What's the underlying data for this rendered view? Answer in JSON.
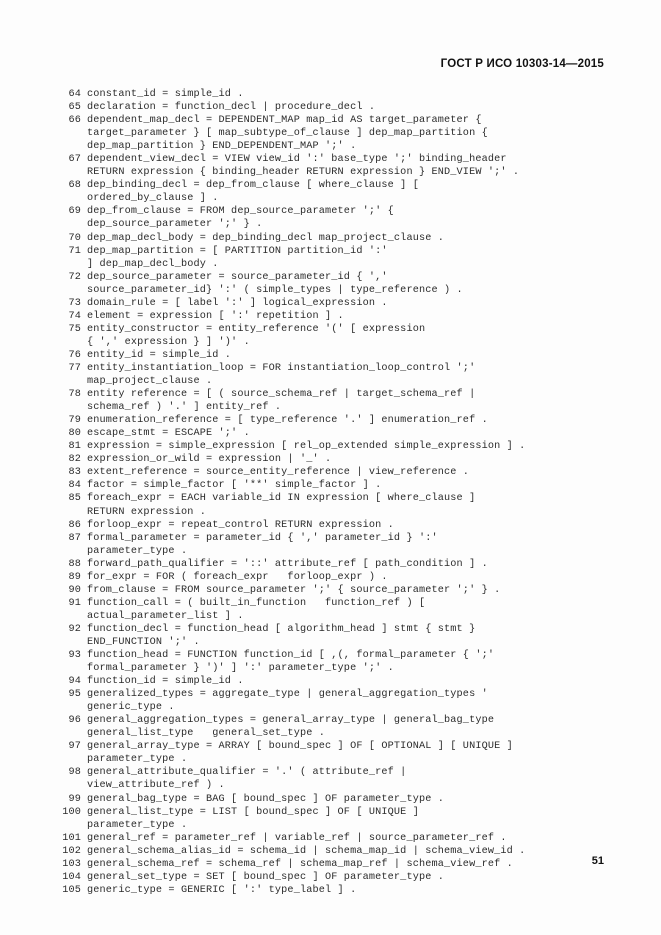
{
  "header": {
    "standard_designation": "ГОСТ Р ИСО 10303-14—2015"
  },
  "footer": {
    "page_number": "51"
  },
  "listing": {
    "rules": [
      {
        "number": "64",
        "lines": [
          "constant_id = simple_id ."
        ]
      },
      {
        "number": "65",
        "lines": [
          "declaration = function_decl | procedure_decl ."
        ]
      },
      {
        "number": "66",
        "lines": [
          "dependent_map_decl = DEPENDENT_MAP map_id AS target_parameter {",
          "target_parameter } [ map_subtype_of_clause ] dep_map_partition {",
          "dep_map_partition } END_DEPENDENT_MAP ';' ."
        ]
      },
      {
        "number": "67",
        "lines": [
          "dependent_view_decl = VIEW view_id ':' base_type ';' binding_header",
          "RETURN expression { binding_header RETURN expression } END_VIEW ';' ."
        ]
      },
      {
        "number": "68",
        "lines": [
          "dep_binding_decl = dep_from_clause [ where_clause ] [",
          "ordered_by_clause ] ."
        ]
      },
      {
        "number": "69",
        "lines": [
          "dep_from_clause = FROM dep_source_parameter ';' {",
          "dep_source_parameter ';' } ."
        ]
      },
      {
        "number": "70",
        "lines": [
          "dep_map_decl_body = dep_binding_decl map_project_clause ."
        ]
      },
      {
        "number": "71",
        "lines": [
          "dep_map_partition = [ PARTITION partition_id ':'",
          "] dep_map_decl_body ."
        ]
      },
      {
        "number": "72",
        "lines": [
          "dep_source_parameter = source_parameter_id { ','",
          "source_parameter_id} ':' ( simple_types | type_reference ) ."
        ]
      },
      {
        "number": "73",
        "lines": [
          "domain_rule = [ label ':' ] logical_expression ."
        ]
      },
      {
        "number": "74",
        "lines": [
          "element = expression [ ':' repetition ] ."
        ]
      },
      {
        "number": "75",
        "lines": [
          "entity_constructor = entity_reference '(' [ expression",
          "{ ',' expression } ] ')' ."
        ]
      },
      {
        "number": "76",
        "lines": [
          "entity_id = simple_id ."
        ]
      },
      {
        "number": "77",
        "lines": [
          "entity_instantiation_loop = FOR instantiation_loop_control ';'",
          "map_project_clause ."
        ]
      },
      {
        "number": "78",
        "lines": [
          "entity reference = [ ( source_schema_ref | target_schema_ref |",
          "schema_ref ) '.' ] entity_ref ."
        ]
      },
      {
        "number": "79",
        "lines": [
          "enumeration_reference = [ type_reference '.' ] enumeration_ref ."
        ]
      },
      {
        "number": "80",
        "lines": [
          "escape_stmt = ESCAPE ';' ."
        ]
      },
      {
        "number": "81",
        "lines": [
          "expression = simple_expression [ rel_op_extended simple_expression ] ."
        ]
      },
      {
        "number": "82",
        "lines": [
          "expression_or_wild = expression | '_' ."
        ]
      },
      {
        "number": "83",
        "lines": [
          "extent_reference = source_entity_reference | view_reference ."
        ]
      },
      {
        "number": "84",
        "lines": [
          "factor = simple_factor [ '**' simple_factor ] ."
        ]
      },
      {
        "number": "85",
        "lines": [
          "foreach_expr = EACH variable_id IN expression [ where_clause ]",
          "RETURN expression ."
        ]
      },
      {
        "number": "86",
        "lines": [
          "forloop_expr = repeat_control RETURN expression ."
        ]
      },
      {
        "number": "87",
        "lines": [
          "formal_parameter = parameter_id { ',' parameter_id } ':'",
          "parameter_type ."
        ]
      },
      {
        "number": "88",
        "lines": [
          "forward_path_qualifier = '::' attribute_ref [ path_condition ] ."
        ]
      },
      {
        "number": "89",
        "lines": [
          "for_expr = FOR ( foreach_expr   forloop_expr ) ."
        ]
      },
      {
        "number": "90",
        "lines": [
          "from_clause = FROM source_parameter ';' { source_parameter ';' } ."
        ]
      },
      {
        "number": "91",
        "lines": [
          "function_call = ( built_in_function   function_ref ) [",
          "actual_parameter_list ] ."
        ]
      },
      {
        "number": "92",
        "lines": [
          "function_decl = function_head [ algorithm_head ] stmt { stmt }",
          "END_FUNCTION ';' ."
        ]
      },
      {
        "number": "93",
        "lines": [
          "function_head = FUNCTION function_id [ ,(, formal_parameter { ';'",
          "formal_parameter } ')' ] ':' parameter_type ';' ."
        ]
      },
      {
        "number": "94",
        "lines": [
          "function_id = simple_id ."
        ]
      },
      {
        "number": "95",
        "lines": [
          "generalized_types = aggregate_type | general_aggregation_types '",
          "generic_type ."
        ]
      },
      {
        "number": "96",
        "lines": [
          "general_aggregation_types = general_array_type | general_bag_type",
          "general_list_type   general_set_type ."
        ]
      },
      {
        "number": "97",
        "lines": [
          "general_array_type = ARRAY [ bound_spec ] OF [ OPTIONAL ] [ UNIQUE ]",
          "parameter_type ."
        ]
      },
      {
        "number": "98",
        "lines": [
          "general_attribute_qualifier = '.' ( attribute_ref |",
          "view_attribute_ref ) ."
        ]
      },
      {
        "number": "99",
        "lines": [
          "general_bag_type = BAG [ bound_spec ] OF parameter_type ."
        ]
      },
      {
        "number": "100",
        "lines": [
          "general_list_type = LIST [ bound_spec ] OF [ UNIQUE ]",
          "parameter_type ."
        ]
      },
      {
        "number": "101",
        "lines": [
          "general_ref = parameter_ref | variable_ref | source_parameter_ref ."
        ]
      },
      {
        "number": "102",
        "lines": [
          "general_schema_alias_id = schema_id | schema_map_id | schema_view_id ."
        ]
      },
      {
        "number": "103",
        "lines": [
          "general_schema_ref = schema_ref | schema_map_ref | schema_view_ref ."
        ]
      },
      {
        "number": "104",
        "lines": [
          "general_set_type = SET [ bound_spec ] OF parameter_type ."
        ]
      },
      {
        "number": "105",
        "lines": [
          "generic_type = GENERIC [ ':' type_label ] ."
        ]
      }
    ]
  }
}
